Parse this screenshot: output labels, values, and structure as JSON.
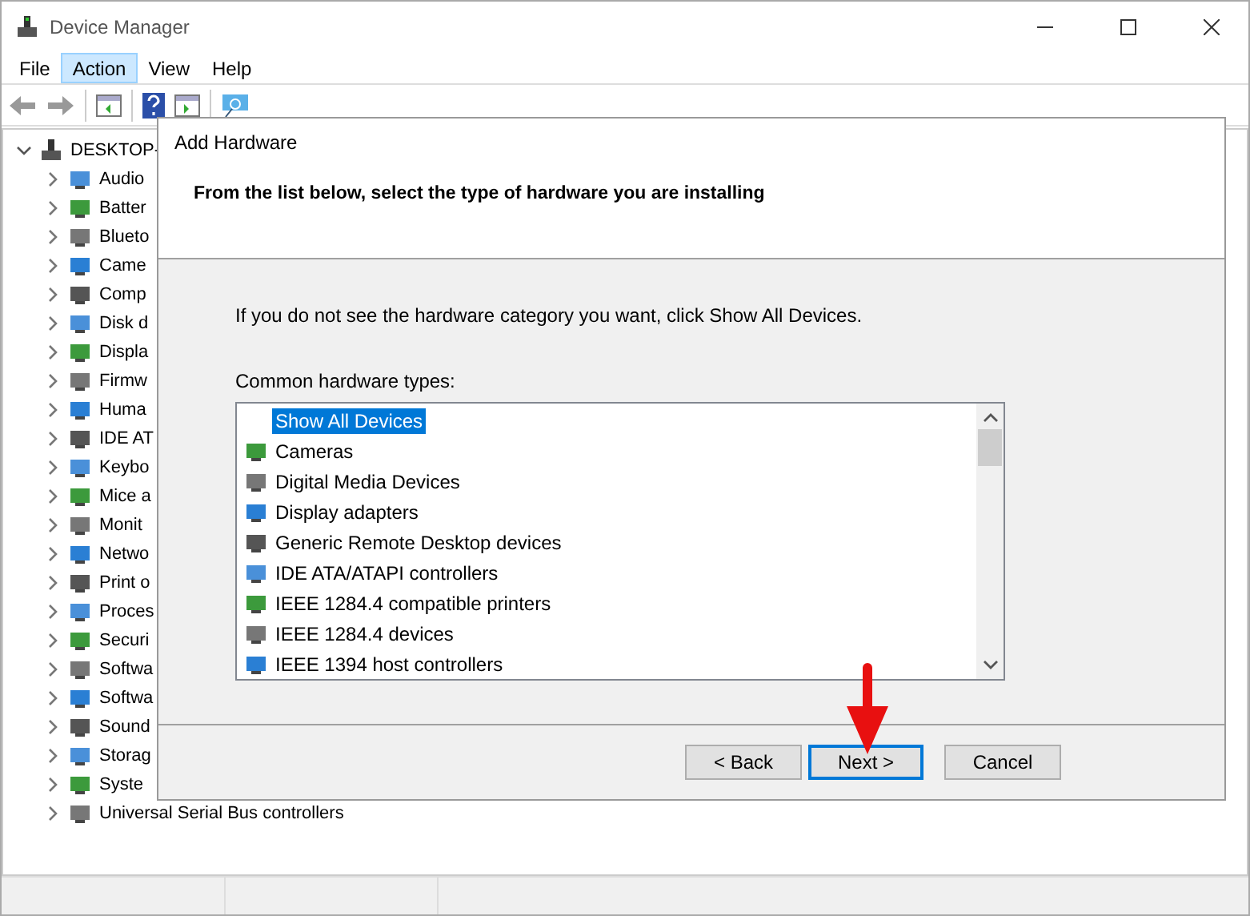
{
  "window": {
    "title": "Device Manager"
  },
  "menu": [
    {
      "label": "File",
      "selected": false
    },
    {
      "label": "Action",
      "selected": true
    },
    {
      "label": "View",
      "selected": false
    },
    {
      "label": "Help",
      "selected": false
    }
  ],
  "tree": {
    "label": "DESKTOP-",
    "expanded": true,
    "children": [
      {
        "label": "Audio",
        "expanded": false
      },
      {
        "label": "Batter",
        "expanded": false
      },
      {
        "label": "Blueto",
        "expanded": false
      },
      {
        "label": "Came",
        "expanded": false
      },
      {
        "label": "Comp",
        "expanded": false
      },
      {
        "label": "Disk d",
        "expanded": false
      },
      {
        "label": "Displa",
        "expanded": false
      },
      {
        "label": "Firmw",
        "expanded": false
      },
      {
        "label": "Huma",
        "expanded": false
      },
      {
        "label": "IDE AT",
        "expanded": false
      },
      {
        "label": "Keybo",
        "expanded": false
      },
      {
        "label": "Mice a",
        "expanded": false
      },
      {
        "label": "Monit",
        "expanded": false
      },
      {
        "label": "Netwo",
        "expanded": false
      },
      {
        "label": "Print o",
        "expanded": false
      },
      {
        "label": "Proces",
        "expanded": false
      },
      {
        "label": "Securi",
        "expanded": false
      },
      {
        "label": "Softwa",
        "expanded": false
      },
      {
        "label": "Softwa",
        "expanded": false
      },
      {
        "label": "Sound",
        "expanded": false
      },
      {
        "label": "Storag",
        "expanded": false
      },
      {
        "label": "Syste",
        "expanded": false
      },
      {
        "label": "Universal Serial Bus controllers",
        "expanded": false
      }
    ]
  },
  "dialog": {
    "title": "Add Hardware",
    "heading": "From the list below, select the type of hardware you are installing",
    "hint": "If you do not see the hardware category you want, click Show All Devices.",
    "list_label": "Common hardware types:",
    "items": [
      {
        "label": "Show All Devices",
        "selected": true,
        "kind": "all"
      },
      {
        "label": "Cameras",
        "selected": false,
        "kind": "device"
      },
      {
        "label": "Digital Media Devices",
        "selected": false,
        "kind": "device"
      },
      {
        "label": "Display adapters",
        "selected": false,
        "kind": "device"
      },
      {
        "label": "Generic Remote Desktop devices",
        "selected": false,
        "kind": "device"
      },
      {
        "label": "IDE ATA/ATAPI controllers",
        "selected": false,
        "kind": "device"
      },
      {
        "label": "IEEE 1284.4 compatible printers",
        "selected": false,
        "kind": "device"
      },
      {
        "label": "IEEE 1284.4 devices",
        "selected": false,
        "kind": "device"
      },
      {
        "label": "IEEE 1394 host controllers",
        "selected": false,
        "kind": "device"
      }
    ],
    "buttons": [
      {
        "label": "< Back",
        "selected": false
      },
      {
        "label": "Next >",
        "selected": true
      },
      {
        "label": "Cancel",
        "selected": false
      }
    ]
  }
}
